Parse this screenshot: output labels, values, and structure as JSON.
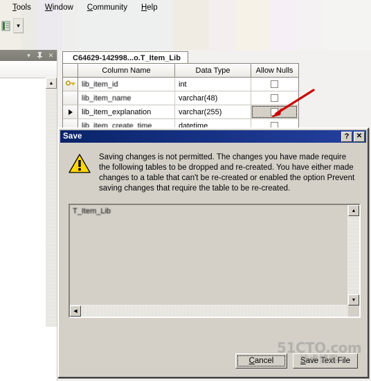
{
  "menubar": {
    "items": [
      {
        "label": "Tools",
        "mnemonic": "T"
      },
      {
        "label": "Window",
        "mnemonic": "W"
      },
      {
        "label": "Community",
        "mnemonic": "C"
      },
      {
        "label": "Help",
        "mnemonic": "H"
      }
    ]
  },
  "toolbar": {
    "icon_name": "database-object-icon",
    "dropdown_glyph": "▾"
  },
  "left_panel": {
    "dropdown_glyph": "▾",
    "pin_glyph": "⚕",
    "close_glyph": "✕",
    "scroll_up_glyph": "▲"
  },
  "designer": {
    "tab_label": "C64629-142998...o.T_Item_Lib",
    "columns": [
      "Column Name",
      "Data Type",
      "Allow Nulls"
    ],
    "rows": [
      {
        "selector": "key",
        "name": "lib_item_id",
        "type": "int",
        "allow_nulls": false,
        "null_cell_selected": false
      },
      {
        "selector": "",
        "name": "lib_item_name",
        "type": "varchar(48)",
        "allow_nulls": false,
        "null_cell_selected": false
      },
      {
        "selector": "current",
        "name": "lib_item_explanation",
        "type": "varchar(255)",
        "allow_nulls": false,
        "null_cell_selected": true
      },
      {
        "selector": "",
        "name": "lib_item_create_time",
        "type": "datetime",
        "allow_nulls": false,
        "null_cell_selected": false
      }
    ]
  },
  "annotation": {
    "arrow_name": "red-callout-arrow",
    "color": "#cc0000"
  },
  "dialog": {
    "title": "Save",
    "help_button": "?",
    "close_button": "✕",
    "icon_name": "warning-triangle-icon",
    "message": "Saving changes is not permitted. The changes you have made require the following tables to be dropped and re-created. You have either made changes to a table that can't be re-created or enabled the option Prevent saving changes that require the table to be re-created.",
    "list_items": [
      "T_Item_Lib"
    ],
    "buttons": [
      {
        "label": "Cancel",
        "mnemonic": "C",
        "focused": true,
        "default": false
      },
      {
        "label": "Save Text File",
        "mnemonic": "S",
        "focused": false,
        "default": false
      }
    ],
    "scroll": {
      "up_glyph": "▲",
      "down_glyph": "▼",
      "left_glyph": "◀"
    }
  },
  "watermark": {
    "top": "51CTO.com",
    "bottom": "技术博客"
  }
}
